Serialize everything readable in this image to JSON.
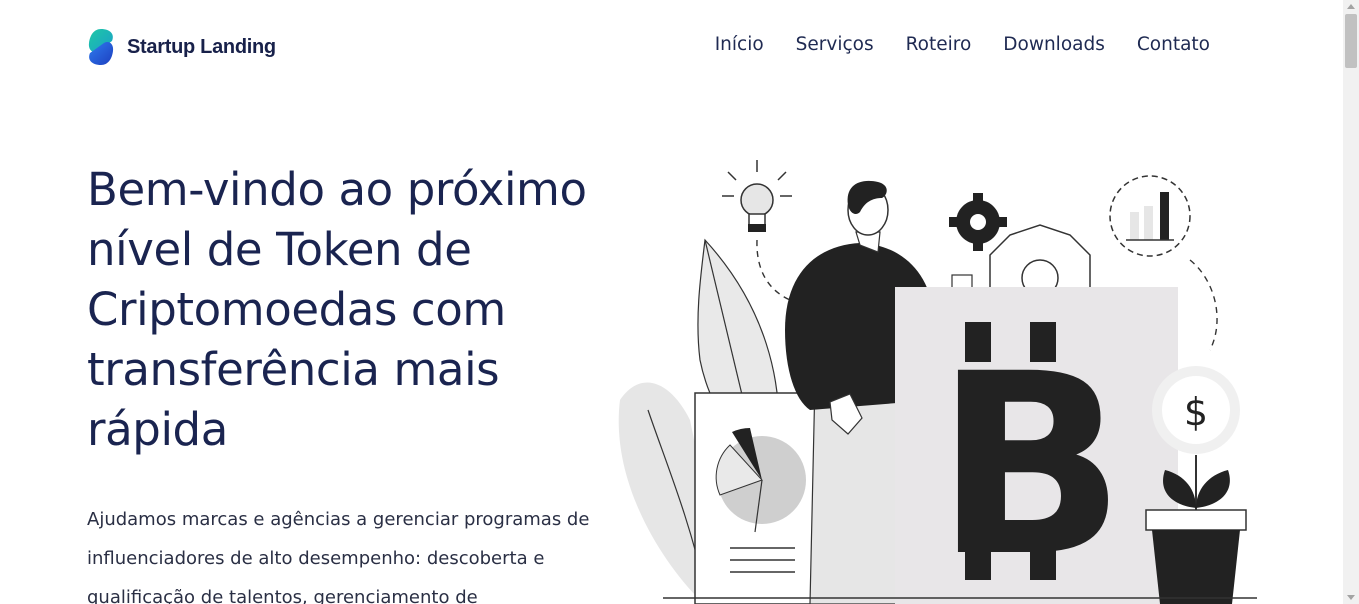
{
  "brand": {
    "name": "Startup Landing",
    "logo_icon": "s-shape-logo-icon",
    "colors": [
      "#14b8a6",
      "#1e4fd8"
    ]
  },
  "nav": {
    "items": [
      "Início",
      "Serviços",
      "Roteiro",
      "Downloads",
      "Contato"
    ]
  },
  "hero": {
    "title": "Bem-vindo ao próximo nível de Token de Criptomoedas com transferência mais rápida",
    "description": "Ajudamos marcas e agências a gerenciar programas de influenciadores de alto desempenho: descoberta e qualificação de talentos, gerenciamento de"
  },
  "illustration": {
    "bitcoin_symbol": "B",
    "dollar_symbol": "$"
  },
  "colors": {
    "text": "#1a2450",
    "accent_dark": "#222222",
    "accent_light": "#e8e6e8"
  }
}
